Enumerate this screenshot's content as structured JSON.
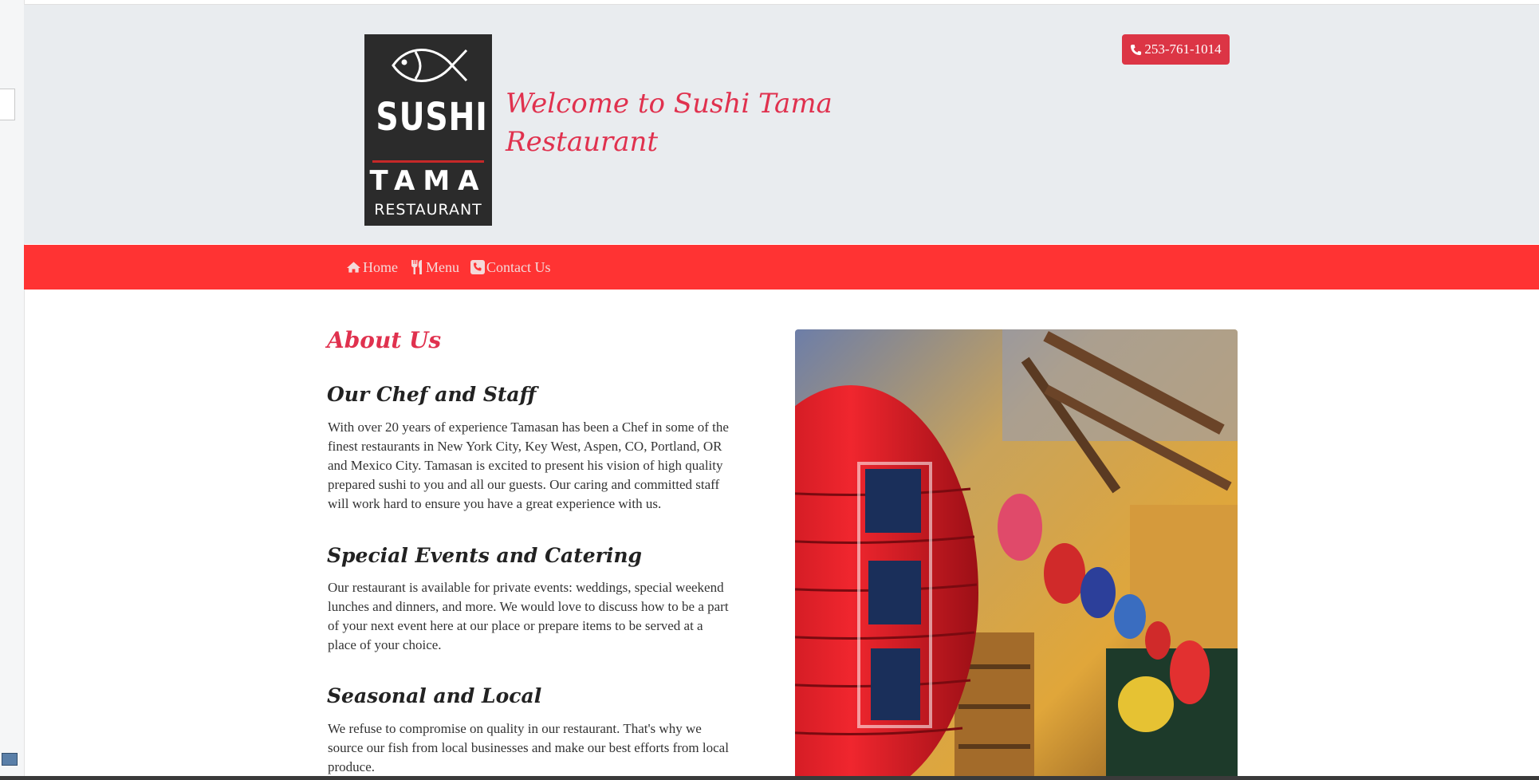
{
  "logo": {
    "line1": "SUSHI",
    "line2": "TAMA",
    "line3": "RESTAURANT"
  },
  "header": {
    "welcome": "Welcome to Sushi Tama Restaurant",
    "phone": "253-761-1014"
  },
  "nav": {
    "items": [
      {
        "label": "Home",
        "icon": "home-icon"
      },
      {
        "label": "Menu",
        "icon": "utensils-icon"
      },
      {
        "label": "Contact Us",
        "icon": "phone-square-icon"
      }
    ]
  },
  "about": {
    "title": "About Us",
    "sections": [
      {
        "heading": "Our Chef and Staff",
        "lines": [
          "With over 20 years of experience Tamasan has been a Chef in some of the",
          "finest restaurants in New York City, Key West, Aspen, CO, Portland, OR",
          "and Mexico City. Tamasan is excited to present his vision of high quality",
          "prepared sushi to you and all our guests. Our caring and committed staff",
          "will work hard to ensure you have a great experience with us."
        ]
      },
      {
        "heading": "Special Events and Catering",
        "lines": [
          "Our restaurant is available for private events: weddings, special weekend",
          "lunches and dinners, and more. We would love to discuss how to be a part",
          "of your next event here at our place or prepare items to be served at a",
          "place of your choice."
        ]
      },
      {
        "heading": "Seasonal and Local",
        "lines": [
          "We refuse to compromise on quality in our restaurant. That's why we",
          "source our fish from local businesses and make our best efforts from local",
          "produce."
        ]
      }
    ]
  },
  "colors": {
    "nav_bg": "#ff3333",
    "accent": "#e0314e",
    "button": "#dc3545",
    "header_bg": "#e9ecef"
  }
}
